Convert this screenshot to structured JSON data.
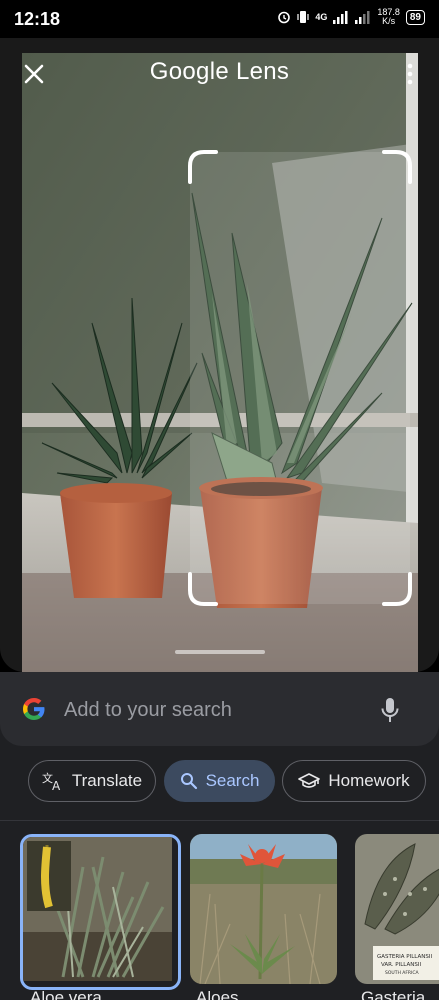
{
  "status_bar": {
    "time": "12:18",
    "network": "4G",
    "speed_value": "187.8",
    "speed_unit": "K/s",
    "battery": "89"
  },
  "header": {
    "title": "Google Lens",
    "close_icon": "close-icon",
    "more_icon": "more-vert-icon"
  },
  "search": {
    "placeholder": "Add to your search",
    "logo": "google-g-icon",
    "mic_icon": "mic-icon"
  },
  "chips": [
    {
      "label": "Translate",
      "icon": "translate-icon",
      "active": false
    },
    {
      "label": "Search",
      "icon": "search-icon",
      "active": true
    },
    {
      "label": "Homework",
      "icon": "school-icon",
      "active": false
    }
  ],
  "results": [
    {
      "title": "Aloe vera",
      "selected": true
    },
    {
      "title": "Aloes",
      "selected": false
    },
    {
      "title": "Gasteria",
      "selected": false
    }
  ],
  "result_image_label": {
    "line1": "GASTERIA PILLANSII",
    "line2": "VAR. PILLANSII",
    "line3": "SOUTH AFRICA"
  },
  "colors": {
    "accent": "#8ab4f8",
    "active_chip_bg": "#3c4a5f",
    "sheet_bg": "#1f2023"
  }
}
